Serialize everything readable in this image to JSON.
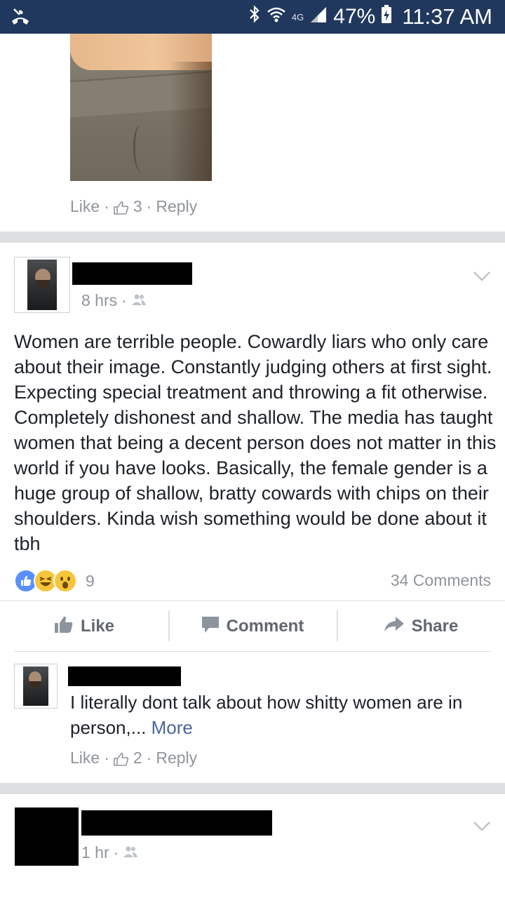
{
  "status_bar": {
    "battery": "47%",
    "time": "11:37 AM",
    "network": "4G"
  },
  "top_comment": {
    "like_label": "Like",
    "reaction_count": "3",
    "reply_label": "Reply",
    "separator": "·"
  },
  "post": {
    "timestamp": "8 hrs",
    "separator": "·",
    "body": "Women are terrible people. Cowardly liars who only care about their image. Constantly judging others at first sight. Expecting special treatment and throwing a fit otherwise. Completely dishonest and shallow. The media has taught women that being a decent person does not matter in this world if you have looks. Basically, the female gender is a huge group of shallow, bratty cowards with chips on their shoulders. Kinda wish something would be done about it tbh",
    "reaction_count": "9",
    "comments_label": "34 Comments",
    "actions": {
      "like": "Like",
      "comment": "Comment",
      "share": "Share"
    }
  },
  "reply_comment": {
    "text": "I literally dont talk about how shitty women are in person,...",
    "more_label": "More",
    "like_label": "Like",
    "reaction_count": "2",
    "reply_label": "Reply",
    "separator": "·"
  },
  "next_post": {
    "timestamp": "1 hr",
    "separator": "·"
  },
  "colors": {
    "status_bar_bg": "#21385e",
    "meta_text": "#90949c",
    "link": "#4b67a1",
    "like_blue": "#5890ff",
    "emoji_yellow": "#f7c53a",
    "separator_gray": "#dddfe2"
  }
}
